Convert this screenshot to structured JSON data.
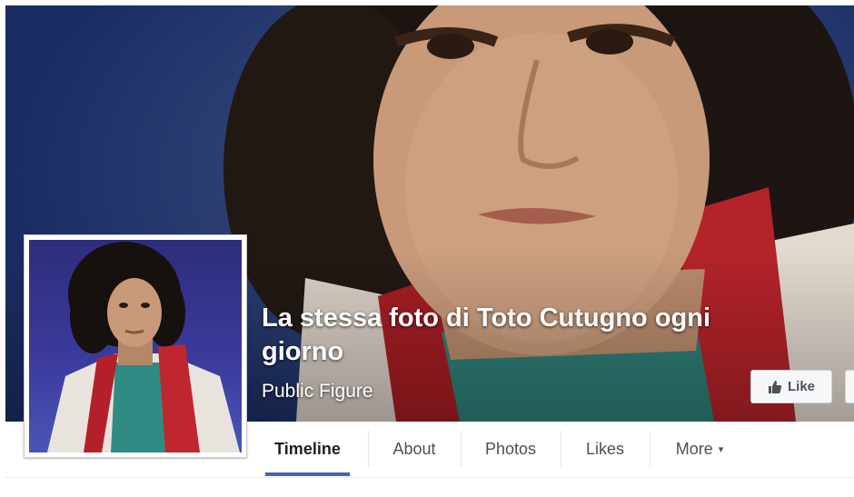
{
  "page": {
    "name": "La stessa foto di Toto Cutugno ogni giorno",
    "category": "Public Figure"
  },
  "actions": {
    "like_label": "Like"
  },
  "nav": {
    "tabs": [
      {
        "label": "Timeline",
        "active": true
      },
      {
        "label": "About",
        "active": false
      },
      {
        "label": "Photos",
        "active": false
      },
      {
        "label": "Likes",
        "active": false
      },
      {
        "label": "More",
        "active": false
      }
    ],
    "more_caret": "▾"
  },
  "icons": {
    "like": "thumbs-up-icon",
    "more": "caret-down-icon"
  },
  "colors": {
    "accent": "#4267b2",
    "cover_background": "#23376b"
  }
}
